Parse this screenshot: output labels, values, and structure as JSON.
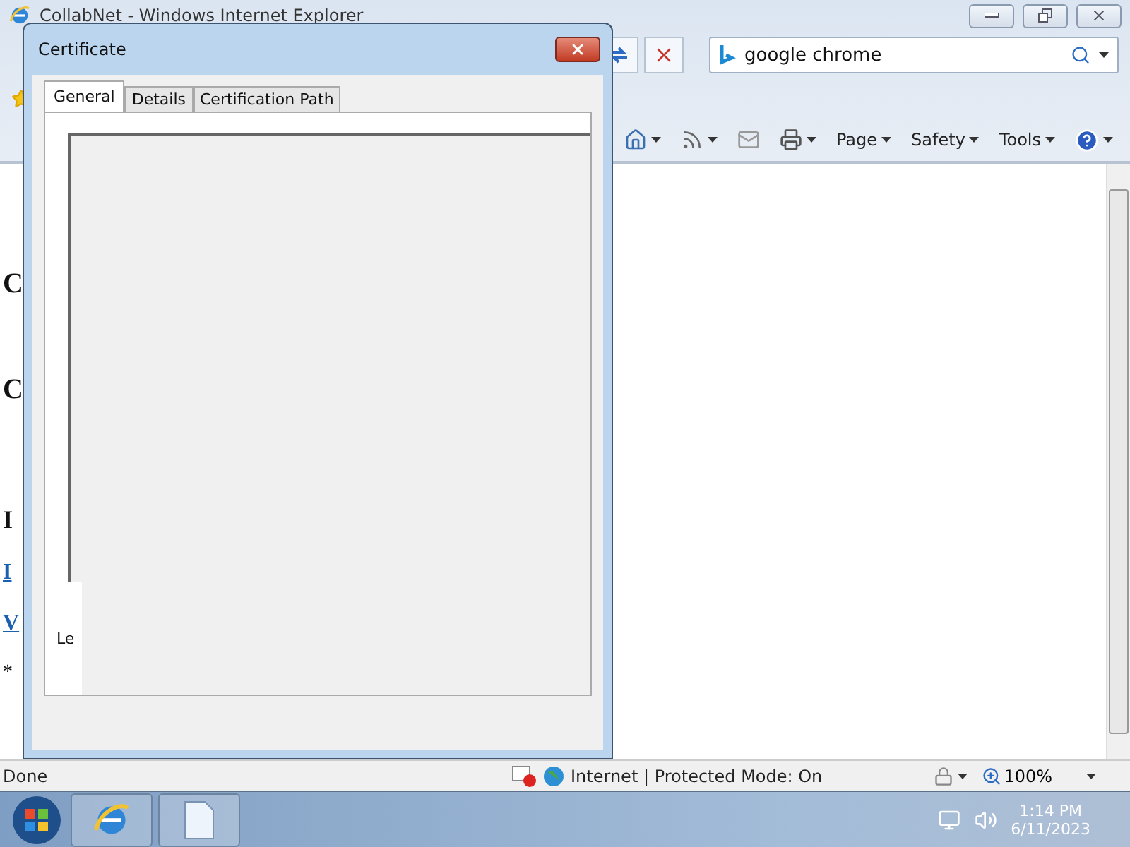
{
  "browser": {
    "title": "CollabNet - Windows Internet Explorer",
    "search": {
      "value": "google chrome"
    },
    "commands": [
      {
        "label": "Page"
      },
      {
        "label": "Safety"
      },
      {
        "label": "Tools"
      }
    ],
    "page_fragments": [
      {
        "text": "C",
        "kind": "heading"
      },
      {
        "text": "C",
        "kind": "heading"
      },
      {
        "text": "I",
        "kind": "subheading"
      },
      {
        "text": "I",
        "kind": "link"
      },
      {
        "text": "V",
        "kind": "link"
      },
      {
        "text": "*",
        "kind": "text"
      }
    ],
    "status": {
      "text": "Done",
      "zone": "Internet | Protected Mode: On",
      "zoom": "100%"
    }
  },
  "dialog": {
    "title": "Certificate",
    "tabs": [
      {
        "label": "General",
        "selected": true
      },
      {
        "label": "Details",
        "selected": false
      },
      {
        "label": "Certification Path",
        "selected": false
      }
    ],
    "fragment": "Le"
  },
  "taskbar": {
    "time": "1:14 PM",
    "date": "6/11/2023"
  }
}
